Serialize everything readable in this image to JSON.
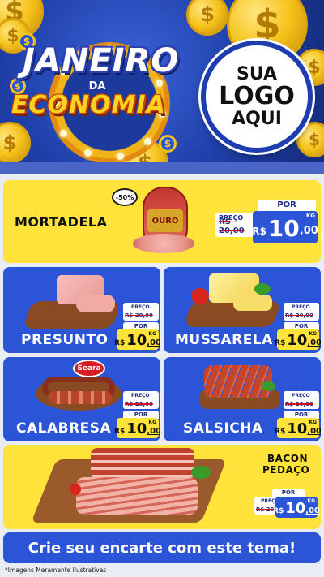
{
  "header": {
    "title_line1": "JANEIRO",
    "title_line2": "DA",
    "title_line3": "ECONOMIA",
    "logo_line1": "SUA",
    "logo_line2": "LOGO",
    "logo_line3": "AQUI",
    "coin_symbol": "$"
  },
  "featured": {
    "name": "MORTADELA",
    "discount": "-50%",
    "brand_label": "OURO",
    "de_label": "PREÇO",
    "de_value": "R$ 20,00",
    "por_label": "POR",
    "currency": "R$",
    "price_int": "10",
    "price_dec": ",00",
    "unit": "KG"
  },
  "products": [
    {
      "name": "PRESUNTO",
      "de_label": "PREÇO",
      "de_value": "R$ 20,00",
      "por_label": "POR",
      "currency": "R$",
      "price_int": "10",
      "price_dec": ",00",
      "unit": "KG"
    },
    {
      "name": "MUSSARELA",
      "de_label": "PREÇO",
      "de_value": "R$ 20,00",
      "por_label": "POR",
      "currency": "R$",
      "price_int": "10",
      "price_dec": ",00",
      "unit": "KG"
    },
    {
      "name": "CALABRESA",
      "brand": "Seara",
      "de_label": "PREÇO",
      "de_value": "R$ 20,00",
      "por_label": "POR",
      "currency": "R$",
      "price_int": "10",
      "price_dec": ",00",
      "unit": "KG"
    },
    {
      "name": "SALSICHA",
      "de_label": "PREÇO",
      "de_value": "R$ 20,00",
      "por_label": "POR",
      "currency": "R$",
      "price_int": "10",
      "price_dec": ",00",
      "unit": "KG"
    }
  ],
  "bacon": {
    "name_line1": "BACON",
    "name_line2": "PEDAÇO",
    "de_label": "PREÇO",
    "de_value": "R$ 20,00",
    "por_label": "POR",
    "currency": "R$",
    "price_int": "10",
    "price_dec": ",00",
    "unit": "KG"
  },
  "cta": {
    "label": "Crie seu encarte com este tema!"
  },
  "disclaimer": "*Imagens Meramente Ilustrativas",
  "colors": {
    "brand_blue": "#2b54d6",
    "brand_yellow": "#ffe33b",
    "strike_red": "#d1121b",
    "dark_navy": "#1b2f8a"
  }
}
